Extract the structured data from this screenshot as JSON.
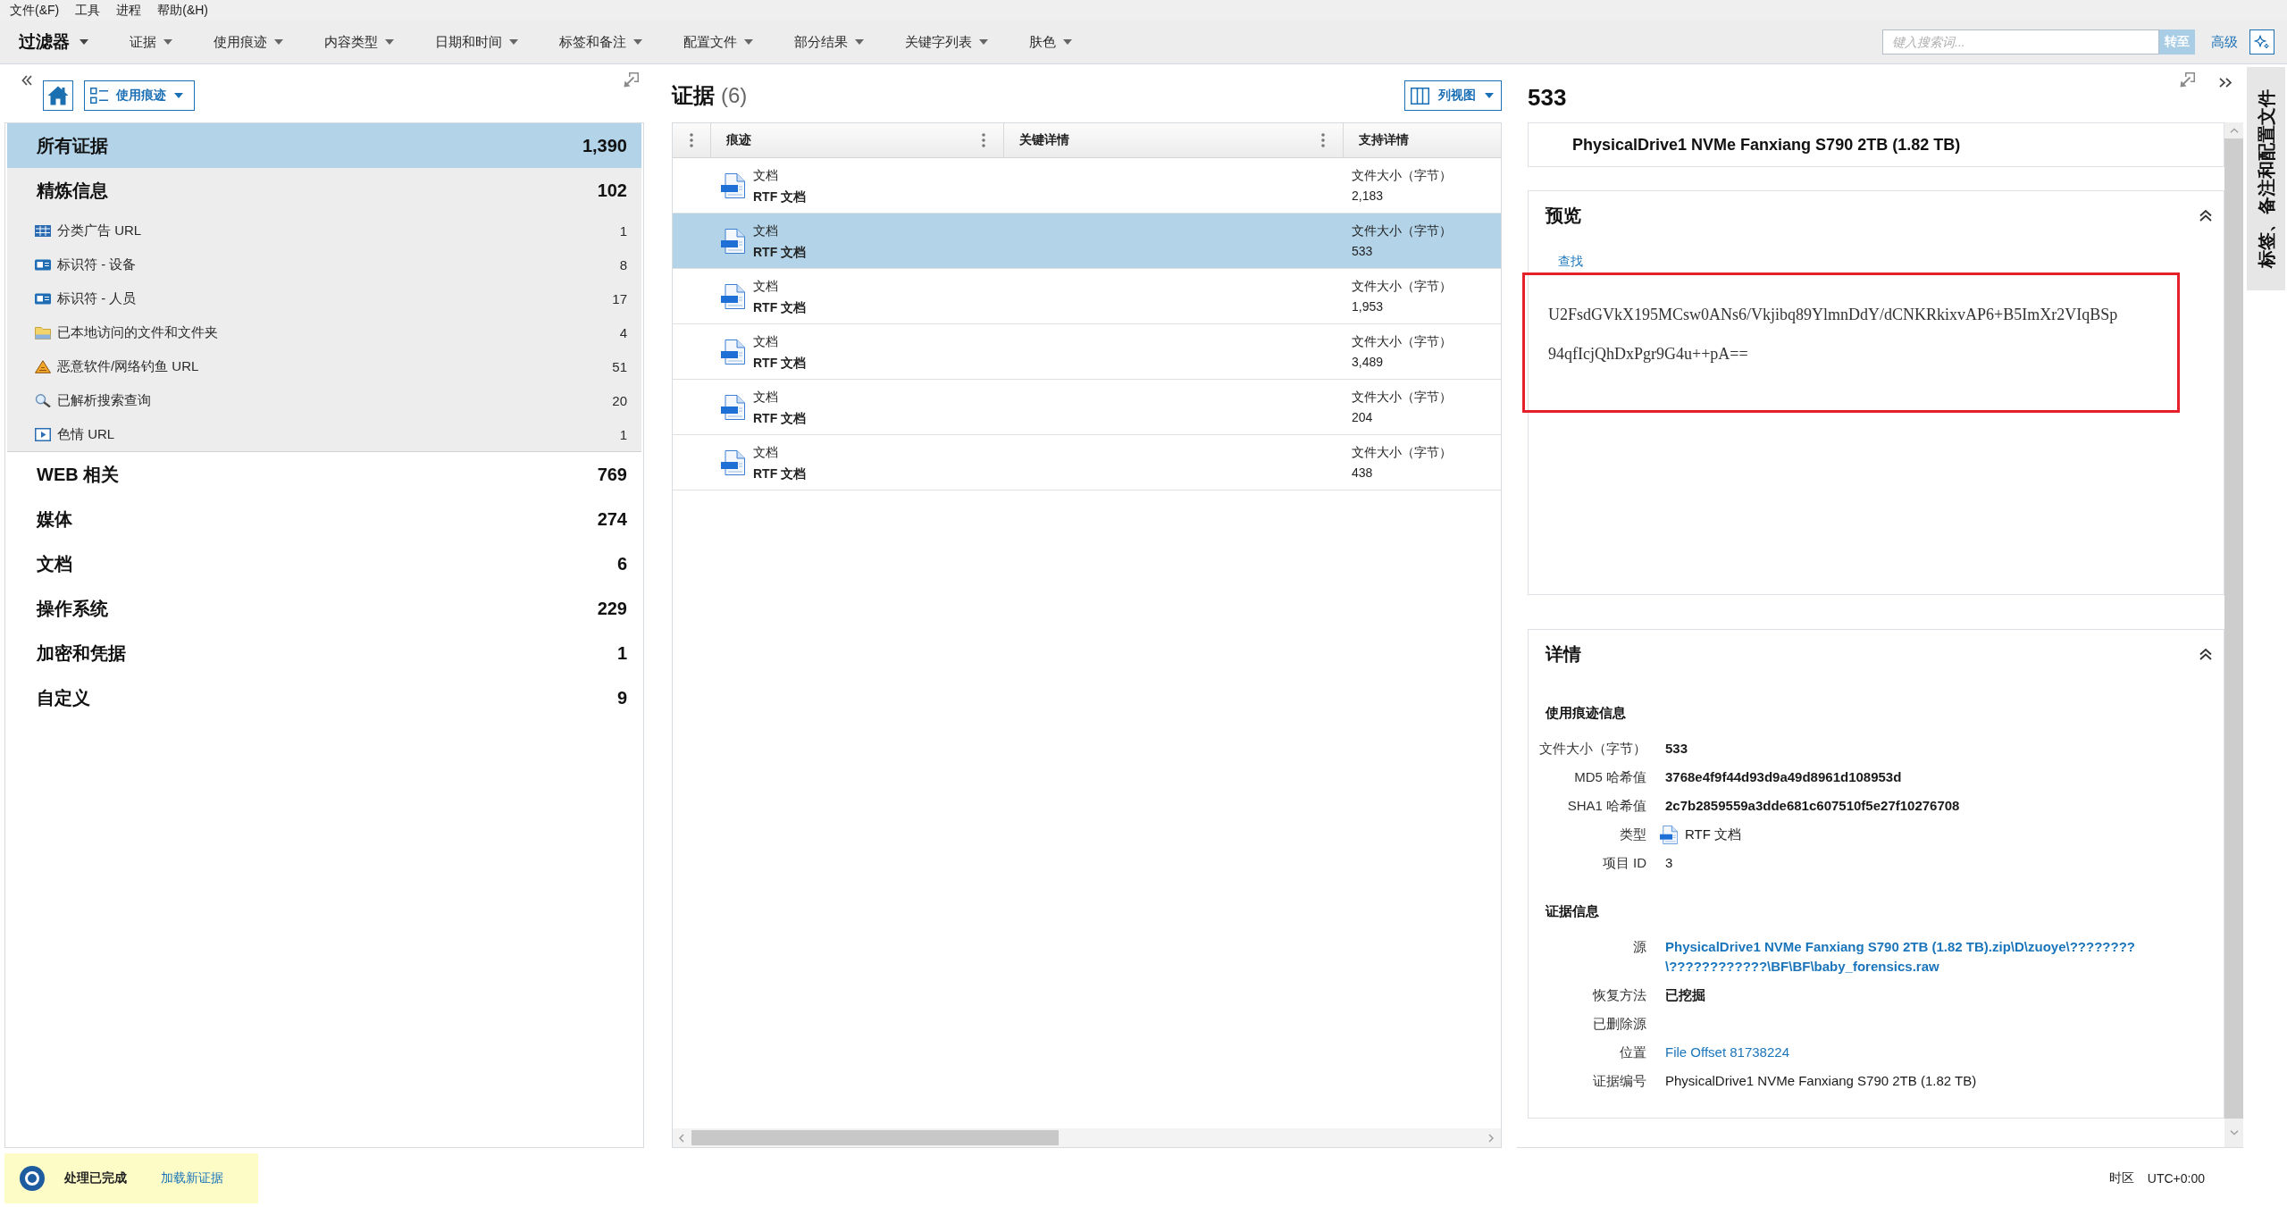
{
  "menu_bar": [
    "文件(&F)",
    "工具",
    "进程",
    "帮助(&H)"
  ],
  "filter_bar": {
    "title": "过滤器",
    "filters": [
      "证据",
      "使用痕迹",
      "内容类型",
      "日期和时间",
      "标签和备注",
      "配置文件",
      "部分结果",
      "关键字列表",
      "肤色"
    ],
    "search": {
      "placeholder": "键入搜索词..."
    },
    "go_button": "转至",
    "advanced_link": "高级"
  },
  "left_panel": {
    "view_button": "使用痕迹",
    "categories": [
      {
        "label": "所有证据",
        "count": "1,390",
        "selected": true
      },
      {
        "label": "精炼信息",
        "count": "102",
        "selected": false,
        "children": [
          {
            "label": "分类广告 URL",
            "count": "1",
            "kind": "table",
            "selected": false
          },
          {
            "label": "标识符 - 设备",
            "count": "8",
            "kind": "idcard",
            "selected": false
          },
          {
            "label": "标识符 - 人员",
            "count": "17",
            "kind": "idcard",
            "selected": false
          },
          {
            "label": "已本地访问的文件和文件夹",
            "count": "4",
            "kind": "folder",
            "selected": false
          },
          {
            "label": "恶意软件/网络钓鱼 URL",
            "count": "51",
            "kind": "warning",
            "selected": false
          },
          {
            "label": "已解析搜索查询",
            "count": "20",
            "kind": "search",
            "selected": false
          },
          {
            "label": "色情 URL",
            "count": "1",
            "kind": "video",
            "selected": false
          }
        ]
      },
      {
        "label": "WEB 相关",
        "count": "769",
        "selected": false
      },
      {
        "label": "媒体",
        "count": "274",
        "selected": false
      },
      {
        "label": "文档",
        "count": "6",
        "selected": false
      },
      {
        "label": "操作系统",
        "count": "229",
        "selected": false
      },
      {
        "label": "加密和凭据",
        "count": "1",
        "selected": false
      },
      {
        "label": "自定义",
        "count": "9",
        "selected": false
      }
    ]
  },
  "evidence_panel": {
    "title": "证据",
    "count": "(6)",
    "view_button": "列视图",
    "table": {
      "columns": [
        "痕迹",
        "关键详情",
        "支持详情"
      ],
      "rows": [
        {
          "type": "文档",
          "name": "RTF 文档",
          "support_label": "文件大小（字节）",
          "support_value": "2,183",
          "selected": false
        },
        {
          "type": "文档",
          "name": "RTF 文档",
          "support_label": "文件大小（字节）",
          "support_value": "533",
          "selected": true
        },
        {
          "type": "文档",
          "name": "RTF 文档",
          "support_label": "文件大小（字节）",
          "support_value": "1,953",
          "selected": false
        },
        {
          "type": "文档",
          "name": "RTF 文档",
          "support_label": "文件大小（字节）",
          "support_value": "3,489",
          "selected": false
        },
        {
          "type": "文档",
          "name": "RTF 文档",
          "support_label": "文件大小（字节）",
          "support_value": "204",
          "selected": false
        },
        {
          "type": "文档",
          "name": "RTF 文档",
          "support_label": "文件大小（字节）",
          "support_value": "438",
          "selected": false
        }
      ]
    }
  },
  "detail_panel": {
    "title": "533",
    "source": "PhysicalDrive1 NVMe Fanxiang S790 2TB (1.82 TB)",
    "preview": {
      "title": "预览",
      "expanded": true,
      "find_link": "查找",
      "lines": [
        "U2FsdGVkX195MCsw0ANs6/Vkjibq89YlmnDdY/dCNKRkixvAP6+B5ImXr2VIqBSp",
        "94qfIcjQhDxPgr9G4u++pA=="
      ]
    },
    "details": {
      "title": "详情",
      "expanded": true,
      "sections": [
        {
          "title": "使用痕迹信息",
          "fields": [
            {
              "label": "文件大小（字节）",
              "value": "533",
              "kind": "strong"
            },
            {
              "label": "MD5 哈希值",
              "value": "3768e4f9f44d93d9a49d8961d108953d",
              "kind": "strong"
            },
            {
              "label": "SHA1 哈希值",
              "value": "2c7b2859559a3dde681c607510f5e27f10276708",
              "kind": "strong"
            },
            {
              "label": "类型",
              "value": "RTF 文档",
              "kind": "filetype"
            },
            {
              "label": "项目 ID",
              "value": "3",
              "kind": "plain"
            }
          ]
        },
        {
          "title": "证据信息",
          "fields": [
            {
              "label": "源",
              "lines": [
                "PhysicalDrive1 NVMe Fanxiang S790 2TB (1.82 TB).zip\\D\\zuoye\\????????",
                "\\????????????\\BF\\BF\\baby_forensics.raw"
              ],
              "kind": "source"
            },
            {
              "label": "恢复方法",
              "value": "已挖掘",
              "kind": "strong"
            },
            {
              "label": "已删除源",
              "kind": "plain"
            },
            {
              "label": "位置",
              "value": "File Offset 81738224",
              "kind": "link"
            },
            {
              "label": "证据编号",
              "value": "PhysicalDrive1 NVMe Fanxiang S790 2TB (1.82 TB)",
              "kind": "plain"
            }
          ]
        }
      ]
    }
  },
  "side_tab": {
    "label": "标签、备注和配置文件"
  },
  "status_bar": {
    "status": "处理已完成",
    "load_link": "加载新证据",
    "timezone_label": "时区",
    "timezone": "UTC+0:00"
  }
}
